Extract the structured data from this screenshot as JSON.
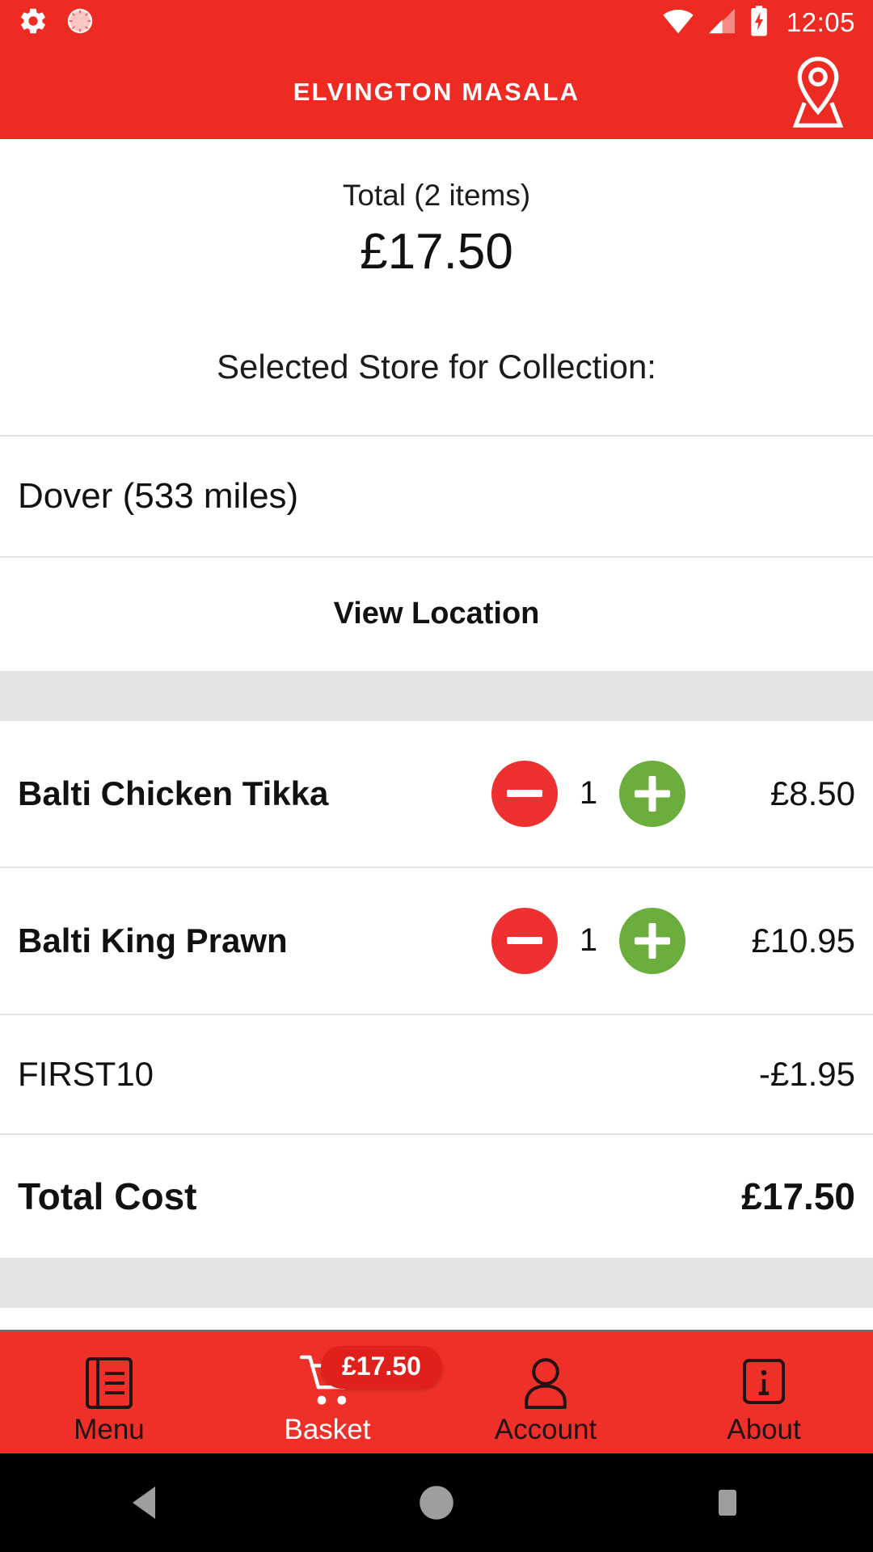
{
  "status_bar": {
    "icons_left": [
      "settings-gear-icon",
      "alarm-clock-icon"
    ],
    "icons_right": [
      "wifi-icon",
      "cellular-signal-icon",
      "battery-charging-icon"
    ],
    "time": "12:05"
  },
  "header": {
    "title": "ELVINGTON MASALA",
    "location_icon": "location-pin-icon",
    "background_color": "#EE2B22"
  },
  "summary": {
    "total_label": "Total (2 items)",
    "total_value": "£17.50"
  },
  "collection": {
    "heading": "Selected Store for Collection:",
    "store_name": "Dover (533 miles)",
    "view_location_label": "View Location"
  },
  "basket_items": [
    {
      "name": "Balti Chicken Tikka",
      "quantity": "1",
      "price": "£8.50",
      "decrease_label": "minus-icon",
      "increase_label": "plus-icon"
    },
    {
      "name": "Balti King Prawn",
      "quantity": "1",
      "price": "£10.95",
      "decrease_label": "minus-icon",
      "increase_label": "plus-icon"
    }
  ],
  "discount": {
    "code": "FIRST10",
    "amount": "-£1.95"
  },
  "total_cost": {
    "label": "Total Cost",
    "value": "£17.50"
  },
  "bottom_nav": {
    "items": [
      {
        "label": "Menu",
        "icon": "menu-book-icon",
        "active": false
      },
      {
        "label": "Basket",
        "icon": "shopping-cart-icon",
        "active": true
      },
      {
        "label": "Account",
        "icon": "person-icon",
        "active": false
      },
      {
        "label": "About",
        "icon": "info-icon",
        "active": false
      }
    ],
    "basket_badge": "£17.50",
    "active_color": "#FFFFFF",
    "inactive_color": "#231215",
    "background_color": "#EE3028",
    "badge_color": "#E0201A"
  },
  "system_nav": {
    "back": "back-triangle-icon",
    "home": "home-circle-icon",
    "recents": "recents-square-icon"
  },
  "colors": {
    "minus_button": "#EE3030",
    "plus_button": "#6CAE3E",
    "divider": "#E2E2E2",
    "band": "#E2E3E5"
  }
}
